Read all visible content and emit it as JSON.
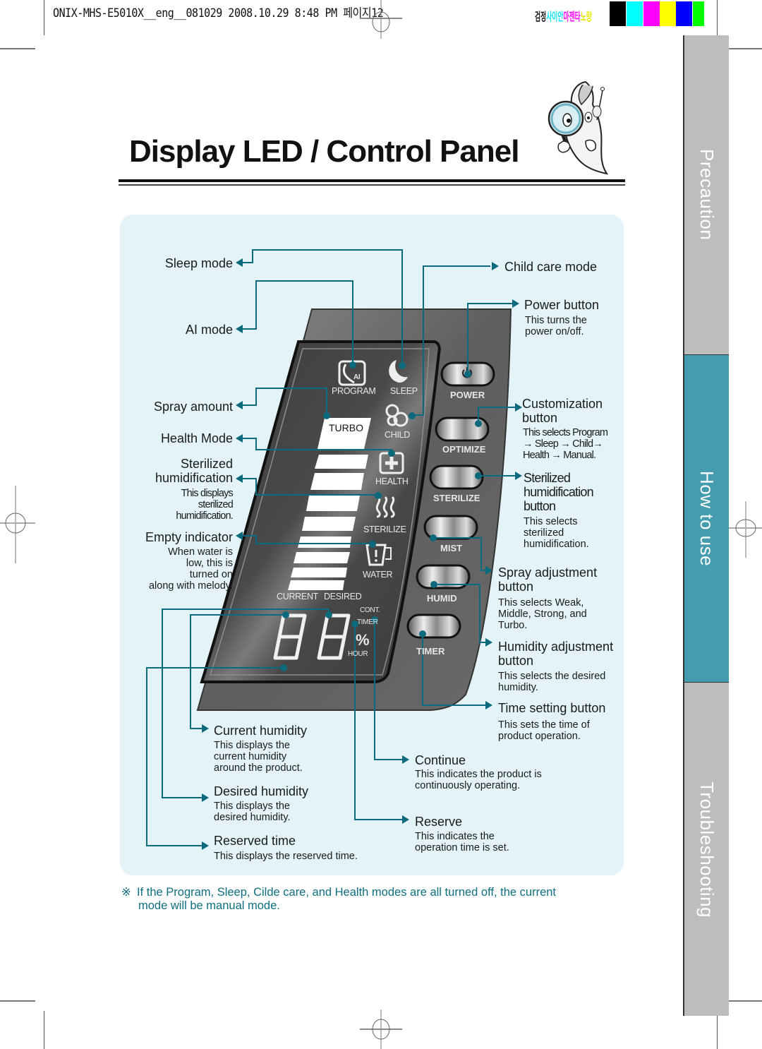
{
  "print_header": {
    "file_info": "ONIX-MHS-E5010X__eng__081029   2008.10.29  8:48 PM   페이지12",
    "color_labels": [
      {
        "text": "검정",
        "color": "#111111"
      },
      {
        "text": "사이안",
        "color": "#00e5ff"
      },
      {
        "text": "마젠타",
        "color": "#ff00ff"
      },
      {
        "text": "노랑",
        "color": "#ffff00"
      }
    ],
    "swatches": [
      "#000000",
      "#00ffff",
      "#ff00ff",
      "#ffff00",
      "#0000ff",
      "#00ff00"
    ]
  },
  "page": {
    "title": "Display LED / Control Panel"
  },
  "side_tabs": [
    {
      "label": "Precaution",
      "active": false,
      "color": "#bdbdbd"
    },
    {
      "label": "How to use",
      "active": true,
      "color": "#459caf"
    },
    {
      "label": "Troubleshooting",
      "active": false,
      "color": "#bdbdbd"
    }
  ],
  "colors": {
    "panel_bg": "#e3f3f7",
    "callout_line": "#0b6a7e",
    "note_text": "#0f6f80",
    "device_body": "#5a5a5a",
    "lcd_bg": "#3e3e3e"
  },
  "device": {
    "lcd": {
      "program": "PROGRAM",
      "program_badge": "AI",
      "sleep": "SLEEP",
      "turbo": "TURBO",
      "child": "CHILD",
      "health": "HEALTH",
      "sterilize": "STERILIZE",
      "water": "WATER",
      "current": "CURRENT",
      "desired": "DESIRED",
      "cont": "CONT.",
      "timer": "TIMER",
      "percent": "%",
      "hour": "HOUR",
      "digits": "88"
    },
    "buttons": [
      {
        "label": "POWER"
      },
      {
        "label": "OPTIMIZE"
      },
      {
        "label": "STERILIZE"
      },
      {
        "label": "MIST"
      },
      {
        "label": "HUMID"
      },
      {
        "label": "TIMER"
      }
    ]
  },
  "callouts_left": {
    "sleep_mode": "Sleep mode",
    "ai_mode": "AI mode",
    "spray_amount": "Spray amount",
    "health_mode": "Health Mode",
    "sterilized_title_1": "Sterilized",
    "sterilized_title_2": "humidification",
    "sterilized_desc": [
      "This displays",
      "sterilized",
      "humidification."
    ],
    "empty_indicator": "Empty indicator",
    "empty_desc": [
      "When water is",
      "low, this is",
      "turned on",
      "along with melody."
    ]
  },
  "callouts_right": {
    "child_care": "Child care mode",
    "power_title": "Power button",
    "power_desc": [
      "This turns the",
      "power on/off."
    ],
    "custom_title": [
      "Customization",
      "button"
    ],
    "custom_desc": [
      "This selects Program",
      "→ Sleep → Child→",
      "Health → Manual."
    ],
    "steril_btn_title": [
      "Sterilized",
      "humidification",
      "button"
    ],
    "steril_btn_desc": [
      "This selects",
      "sterilized",
      "humidification."
    ],
    "spray_title": [
      "Spray adjustment",
      "button"
    ],
    "spray_desc": [
      "This selects Weak,",
      "Middle, Strong, and",
      "Turbo."
    ],
    "humid_title": [
      "Humidity adjustment",
      "button"
    ],
    "humid_desc": [
      "This selects the desired",
      "humidity."
    ],
    "time_title": "Time setting button",
    "time_desc": [
      "This sets the time of",
      "product operation."
    ]
  },
  "callouts_bottom": {
    "current_title": "Current humidity",
    "current_desc": [
      "This displays the",
      "current humidity",
      "around the product."
    ],
    "desired_title": "Desired humidity",
    "desired_desc": [
      "This displays the",
      "desired humidity."
    ],
    "reserved_title": "Reserved time",
    "reserved_desc": "This displays the reserved time.",
    "continue_title": "Continue",
    "continue_desc": [
      "This indicates the product is",
      "continuously operating."
    ],
    "reserve_title": "Reserve",
    "reserve_desc": [
      "This indicates the",
      "operation time is set."
    ]
  },
  "footnote": {
    "mark": "※",
    "text_line1": "If the Program, Sleep, Cilde care, and Health modes are all turned off, the current",
    "text_line2": "mode will be manual mode."
  }
}
